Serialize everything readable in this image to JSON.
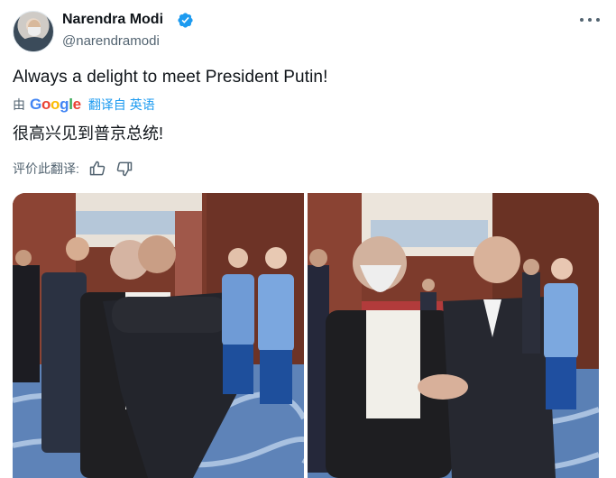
{
  "author": {
    "name": "Narendra Modi",
    "handle": "@narendramodi",
    "verified_icon": "verified-badge-icon",
    "accent": "#1d9bf0"
  },
  "tweet": {
    "text": "Always a delight to meet President Putin!",
    "translation_by": "由",
    "google_logo": "Google",
    "translate_link": "翻译自 英语",
    "translated_text": "很高兴见到普京总统!",
    "rate_label": "评价此翻译:"
  },
  "icons": {
    "more": "more-horizontal-icon",
    "like": "thumbs-up-icon",
    "dislike": "thumbs-down-icon"
  },
  "media": {
    "images": [
      "photo-hug",
      "photo-handshake"
    ]
  }
}
